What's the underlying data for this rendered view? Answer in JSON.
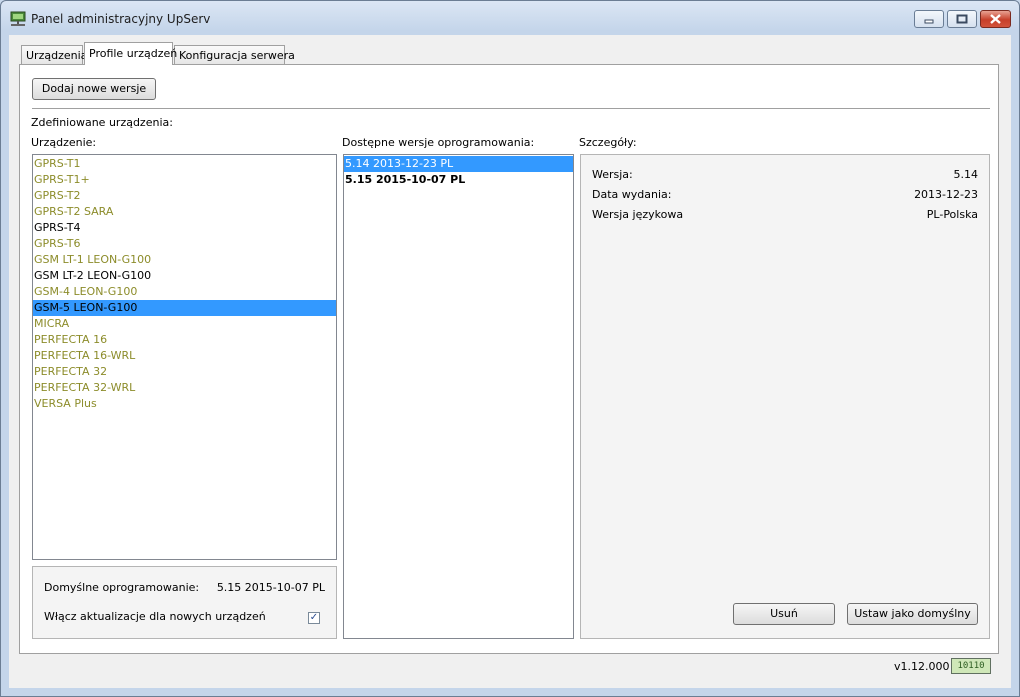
{
  "window": {
    "title": "Panel administracyjny UpServ"
  },
  "tabs": [
    {
      "label": "Urządzenia"
    },
    {
      "label": "Profile urządzeń"
    },
    {
      "label": "Konfiguracja serwera"
    }
  ],
  "toolbar": {
    "add_versions_label": "Dodaj nowe wersje"
  },
  "defined_devices_label": "Zdefiniowane urządzenia:",
  "devices": {
    "header": "Urządzenie:",
    "items": [
      "GPRS-T1",
      "GPRS-T1+",
      "GPRS-T2",
      "GPRS-T2 SARA",
      "GPRS-T4",
      "GPRS-T6",
      "GSM LT-1 LEON-G100",
      "GSM LT-2 LEON-G100",
      "GSM-4 LEON-G100",
      "GSM-5 LEON-G100",
      "MICRA",
      "PERFECTA 16",
      "PERFECTA 16-WRL",
      "PERFECTA 32",
      "PERFECTA 32-WRL",
      "VERSA Plus"
    ],
    "selected_index": 9
  },
  "versions": {
    "header": "Dostępne wersje oprogramowania:",
    "items": [
      "5.14 2013-12-23 PL",
      "5.15 2015-10-07 PL"
    ],
    "selected_index": 0
  },
  "defaults": {
    "default_firmware_label": "Domyślne oprogramowanie:",
    "default_firmware_value": "5.15 2015-10-07 PL",
    "enable_updates_label": "Włącz aktualizacje dla nowych urządzeń",
    "enable_updates_checked": true
  },
  "details": {
    "header": "Szczegóły:",
    "version_label": "Wersja:",
    "version_value": "5.14",
    "release_date_label": "Data wydania:",
    "release_date_value": "2013-12-23",
    "language_label": "Wersja językowa",
    "language_value": "PL-Polska",
    "delete_label": "Usuń",
    "set_default_label": "Ustaw jako domyślny"
  },
  "footer": {
    "version": "v1.12.000"
  },
  "colors": {
    "accent": "#3399ff",
    "olive_text": "#8c8c2a"
  }
}
